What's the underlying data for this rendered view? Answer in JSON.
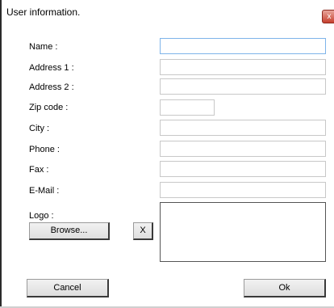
{
  "window": {
    "title": "User information.",
    "close_glyph": "x"
  },
  "form": {
    "name_label": "Name :",
    "name_value": "",
    "address1_label": "Address 1 :",
    "address1_value": "",
    "address2_label": "Address 2 :",
    "address2_value": "",
    "zip_label": "Zip code :",
    "zip_value": "",
    "city_label": "City :",
    "city_value": "",
    "phone_label": "Phone :",
    "phone_value": "",
    "fax_label": "Fax :",
    "fax_value": "",
    "email_label": "E-Mail :",
    "email_value": "",
    "logo_label": "Logo :"
  },
  "buttons": {
    "browse": "Browse...",
    "clear_logo": "X",
    "cancel": "Cancel",
    "ok": "Ok"
  },
  "colors": {
    "focus_border": "#7eb4ea",
    "close_button": "#c7402e"
  }
}
